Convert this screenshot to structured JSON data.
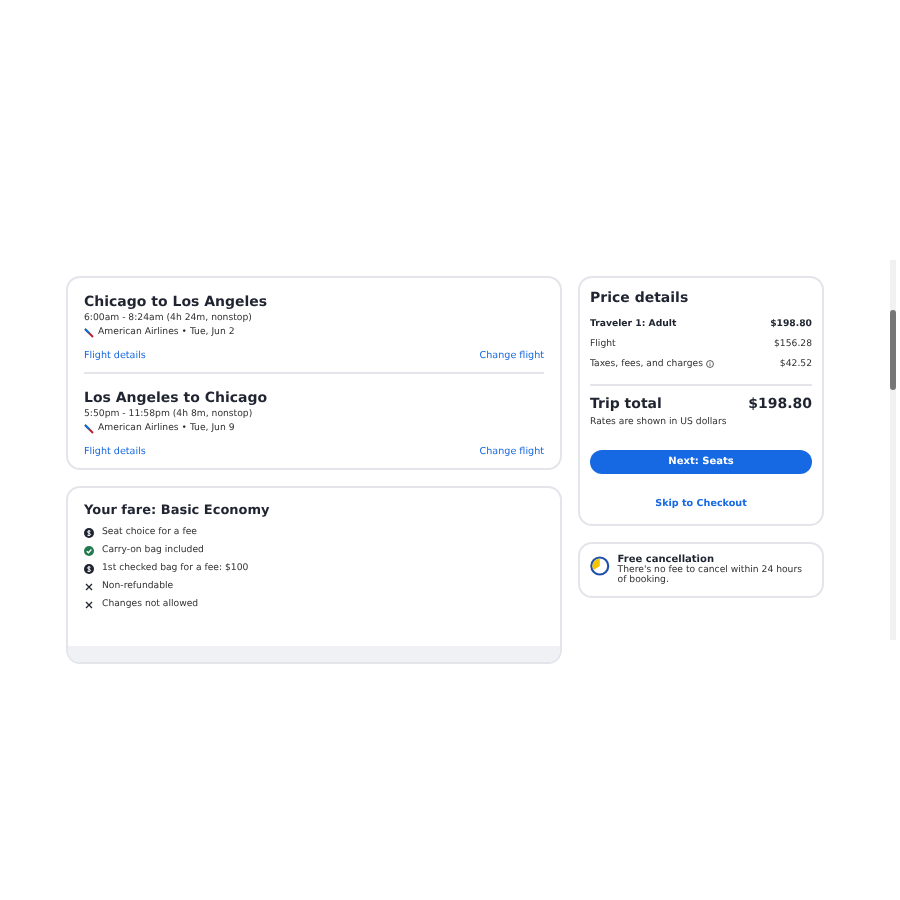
{
  "flights": [
    {
      "route": "Chicago to Los Angeles",
      "times": "6:00am - 8:24am (4h 24m, nonstop)",
      "carrier": "American Airlines • Tue, Jun 2",
      "details_link": "Flight details",
      "change_link": "Change flight"
    },
    {
      "route": "Los Angeles to Chicago",
      "times": "5:50pm - 11:58pm (4h 8m, nonstop)",
      "carrier": "American Airlines • Tue, Jun 9",
      "details_link": "Flight details",
      "change_link": "Change flight"
    }
  ],
  "fare": {
    "title": "Your fare: Basic Economy",
    "items": [
      {
        "kind": "fee",
        "label": "Seat choice for a fee"
      },
      {
        "kind": "included",
        "label": "Carry-on bag included"
      },
      {
        "kind": "fee",
        "label": "1st checked bag for a fee: $100"
      },
      {
        "kind": "none",
        "label": "Non-refundable"
      },
      {
        "kind": "none",
        "label": "Changes not allowed"
      }
    ]
  },
  "price": {
    "title": "Price details",
    "rows": [
      {
        "label": "Traveler 1: Adult",
        "amount": "$198.80",
        "bold": true,
        "info": false
      },
      {
        "label": "Flight",
        "amount": "$156.28",
        "bold": false,
        "info": false
      },
      {
        "label": "Taxes, fees, and charges",
        "amount": "$42.52",
        "bold": false,
        "info": true
      }
    ],
    "total_label": "Trip total",
    "total": "$198.80",
    "note": "Rates are shown in US dollars",
    "primary_button": "Next: Seats",
    "secondary_link": "Skip to Checkout"
  },
  "cancellation": {
    "title": "Free cancellation",
    "text": "There's no fee to cancel within 24 hours of booking."
  }
}
